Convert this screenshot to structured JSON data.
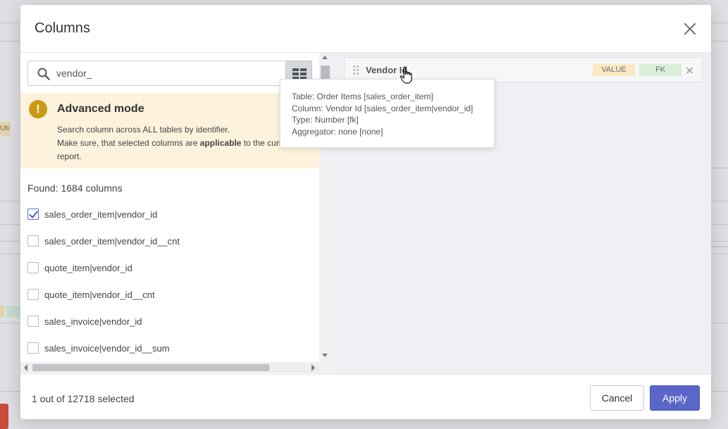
{
  "modal": {
    "title": "Columns"
  },
  "search": {
    "value": "vendor_"
  },
  "advanced_mode": {
    "title": "Advanced mode",
    "line1": "Search column across ALL tables by identifier.",
    "line2_prefix": "Make sure, that selected columns are ",
    "line2_bold": "applicable",
    "line2_suffix": " to the current",
    "line3": "report."
  },
  "found_text": "Found: 1684 columns",
  "columns": [
    {
      "label": "sales_order_item|vendor_id",
      "checked": true
    },
    {
      "label": "sales_order_item|vendor_id__cnt",
      "checked": false
    },
    {
      "label": "quote_item|vendor_id",
      "checked": false
    },
    {
      "label": "quote_item|vendor_id__cnt",
      "checked": false
    },
    {
      "label": "sales_invoice|vendor_id",
      "checked": false
    },
    {
      "label": "sales_invoice|vendor_id__sum",
      "checked": false
    }
  ],
  "selected": {
    "name": "Vendor Id",
    "badge_value": "VALUE",
    "badge_fk": "FK"
  },
  "tooltip": {
    "table": "Table: Order Items [sales_order_item]",
    "column": "Column: Vendor Id [sales_order_item|vendor_id]",
    "type": "Type: Number [fk]",
    "aggregator": "Aggregator: none [none]"
  },
  "footer": {
    "selected_count": "1 out of 12718 selected",
    "cancel_label": "Cancel",
    "apply_label": "Apply"
  },
  "background": {
    "fragment_label": "UM"
  },
  "colors": {
    "accent": "#5b66c9",
    "warning_bg": "#fdf3dc",
    "warning_icon": "#c99a12",
    "badge_value": "#fbe9c4",
    "badge_fk": "#d9efd8"
  },
  "icons": [
    "search-icon",
    "grid-toggle-icon",
    "warning-icon",
    "drag-handle-icon",
    "close-icon",
    "remove-icon",
    "hand-cursor-icon"
  ]
}
